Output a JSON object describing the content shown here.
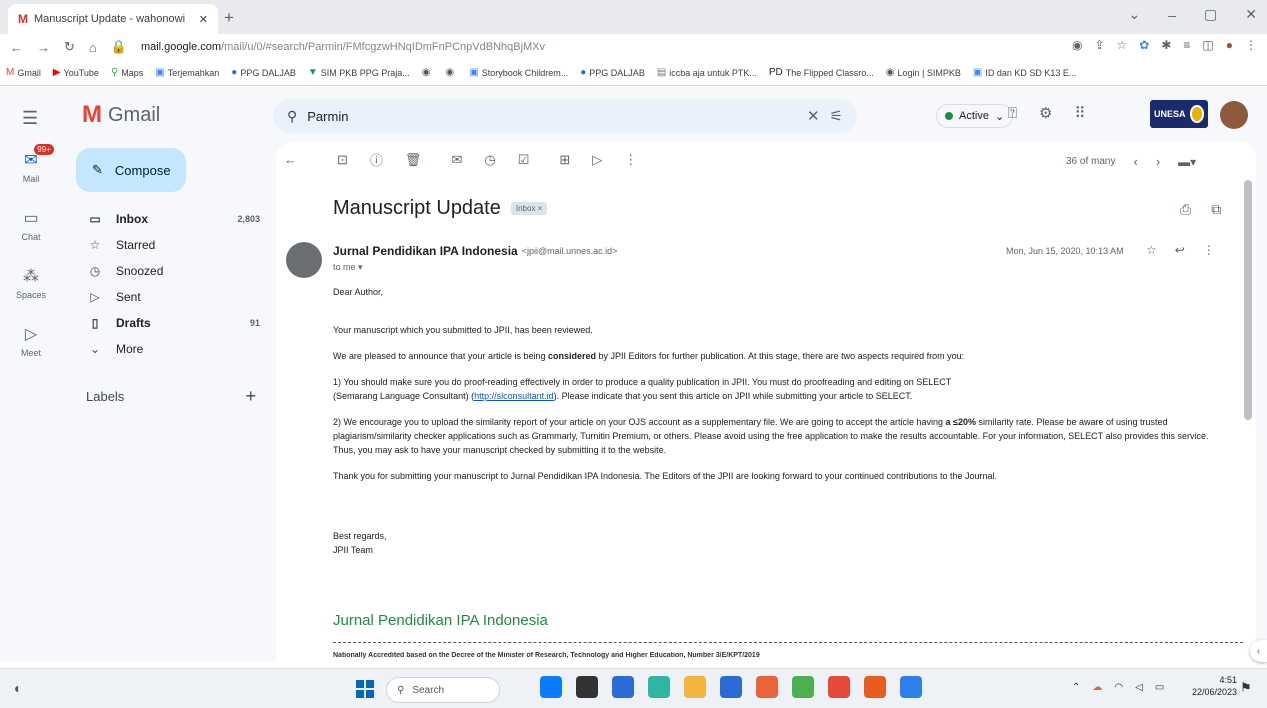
{
  "browser": {
    "tab_title": "Manuscript Update - wahonowi",
    "tab_icon": "M",
    "url_host": "mail.google.com",
    "url_path": "/mail/u/0/#search/Parmin/FMfcgzwHNqIDmFnPCnpVdBNhqBjMXv",
    "new_tab": "+",
    "controls": [
      "⌄",
      "–",
      "▢",
      "✕"
    ]
  },
  "bookmarks": [
    {
      "icon": "M",
      "label": "Gmail",
      "color": "#ea4335"
    },
    {
      "icon": "▶",
      "label": "YouTube",
      "color": "#ff0000"
    },
    {
      "icon": "⚲",
      "label": "Maps",
      "color": "#34a853"
    },
    {
      "icon": "▣",
      "label": "Terjemahkan",
      "color": "#4285f4"
    },
    {
      "icon": "●",
      "label": "PPG DALJAB",
      "color": "#1a73e8"
    },
    {
      "icon": "▼",
      "label": "SIM PKB PPG Praja...",
      "color": "#0f9d58"
    },
    {
      "icon": "◉",
      "label": "",
      "color": "#555"
    },
    {
      "icon": "◉",
      "label": "",
      "color": "#555"
    },
    {
      "icon": "▣",
      "label": "Storybook Childrem...",
      "color": "#4285f4"
    },
    {
      "icon": "●",
      "label": "PPG DALJAB",
      "color": "#1a73e8"
    },
    {
      "icon": "▤",
      "label": "iccba aja untuk PTK...",
      "color": "#777"
    },
    {
      "icon": "PD",
      "label": "The Flipped Classro...",
      "color": "#222"
    },
    {
      "icon": "◉",
      "label": "Login | SIMPKB",
      "color": "#555"
    },
    {
      "icon": "▣",
      "label": "ID dan KD SD K13 E...",
      "color": "#4285f4"
    }
  ],
  "gmail": {
    "app_name": "Gmail",
    "search_query": "Parmin",
    "status": "Active",
    "unesa": "UNESA",
    "rail": [
      {
        "label": "Mail",
        "icon": "✉",
        "badge": "99+"
      },
      {
        "label": "Chat",
        "icon": "▭",
        "badge": ""
      },
      {
        "label": "Spaces",
        "icon": "⁂",
        "badge": ""
      },
      {
        "label": "Meet",
        "icon": "▷",
        "badge": ""
      }
    ],
    "compose": "Compose",
    "nav": [
      {
        "label": "Inbox",
        "count": "2,803",
        "icon": "▭",
        "bold": true
      },
      {
        "label": "Starred",
        "count": "",
        "icon": "☆",
        "bold": false
      },
      {
        "label": "Snoozed",
        "count": "",
        "icon": "◷",
        "bold": false
      },
      {
        "label": "Sent",
        "count": "",
        "icon": "▷",
        "bold": false
      },
      {
        "label": "Drafts",
        "count": "91",
        "icon": "▯",
        "bold": true
      },
      {
        "label": "More",
        "count": "",
        "icon": "⌄",
        "bold": false
      }
    ],
    "labels_heading": "Labels",
    "labels_add": "+"
  },
  "message": {
    "pager": "36 of many",
    "subject": "Manuscript Update",
    "chip": "Inbox ×",
    "sender_name": "Jurnal Pendidikan IPA Indonesia",
    "sender_email": "<jpii@mail.unnes.ac.id>",
    "to": "to me ▾",
    "date": "Mon, Jun 15, 2020, 10:13 AM",
    "greeting": "Dear Author,",
    "p1": "Your manuscript which you submitted to JPII, has been reviewed.",
    "p2_pre": "We are pleased to announce that your article is being ",
    "p2_bold": "considered",
    "p2_post": " by JPII Editors for further publication. At this stage, there are two aspects required from you:",
    "p3_a": "1) You should make sure you do proof-reading effectively in order to produce a quality publication in JPII. You must do proofreading and editing on SELECT",
    "p3_b": "(Semarang Language Consultant) (",
    "p3_link": "http://slconsultant.id",
    "p3_c": "). Please indicate that you sent this article on JPII  while submitting your article to SELECT.",
    "p4_a": "2) We encourage you to upload the similarity report of your article on your OJS account as a supplementary file. We are going to accept the article having ",
    "p4_bold": "a ≤20%",
    "p4_b": " similarity rate. Please be aware of using trusted plagiarism/similarity checker applications such as Grammarly, Turnitin Premium, or others. Please avoid using the free application to make the results accountable. For your information, SELECT  also provides this service. Thus, you may ask to have your manuscript checked by submitting it to the website.",
    "p5": "Thank you for submitting your manuscript to Jurnal Pendidikan IPA Indonesia. The Editors of the JPII are looking forward to your continued contributions to the Journal.",
    "closing1": "Best regards,",
    "closing2": "JPII Team",
    "signature": "Jurnal Pendidikan IPA Indonesia",
    "footer": "Nationally Accredited based on the Decree of the Minister of Research, Technology and Higher Education, Number 3/E/KPT/2019"
  },
  "taskbar": {
    "search": "Search",
    "time": "4:51",
    "date": "22/06/2023",
    "apps": [
      "#0a7cff",
      "#333",
      "#2c6bd6",
      "#2fb5a1",
      "#f3b43d",
      "#2c6bd6",
      "#e8643a",
      "#4caf50",
      "#e8483a",
      "#e85d1f",
      "#2f80ed"
    ]
  }
}
